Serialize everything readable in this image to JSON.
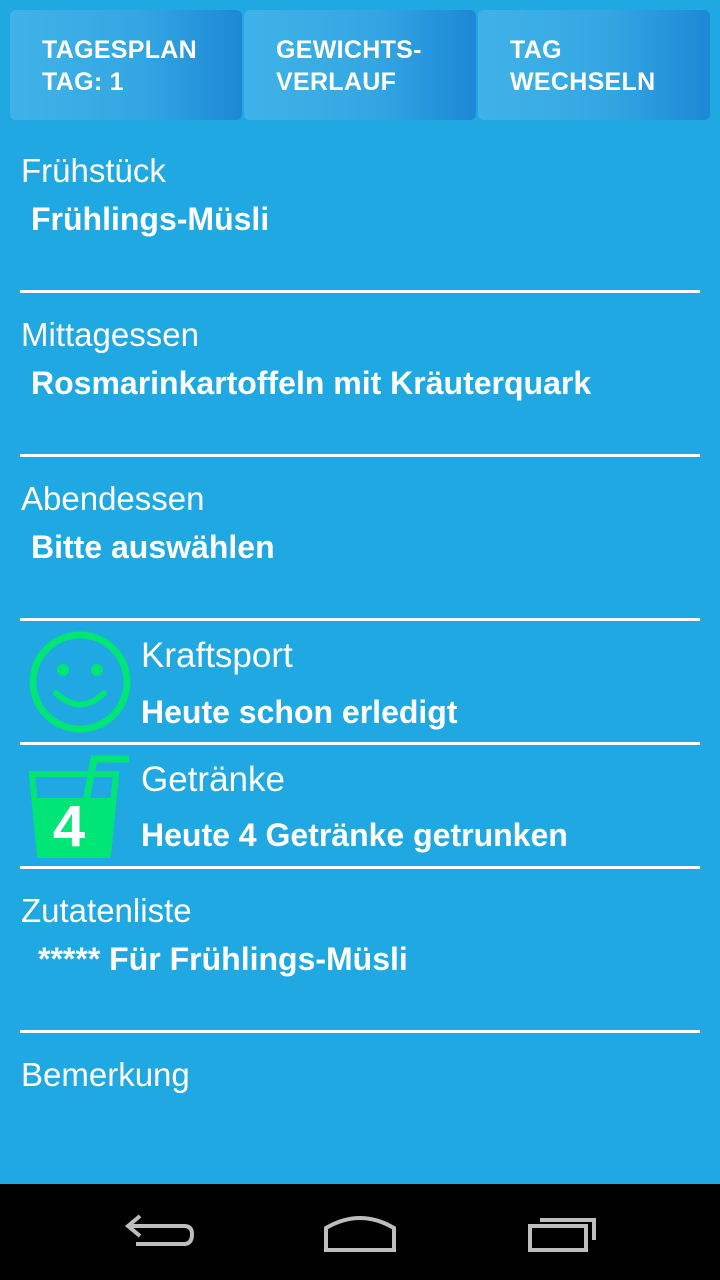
{
  "tabs": [
    {
      "line1": "TAGESPLAN",
      "line2": "TAG: 1"
    },
    {
      "line1": "GEWICHTS-",
      "line2": "VERLAUF"
    },
    {
      "line1": "TAG",
      "line2": "WECHSELN"
    }
  ],
  "breakfast": {
    "label": "Frühstück",
    "value": "Frühlings-Müsli"
  },
  "lunch": {
    "label": "Mittagessen",
    "value": "Rosmarinkartoffeln mit Kräuterquark"
  },
  "dinner": {
    "label": "Abendessen",
    "value": "Bitte auswählen"
  },
  "sport": {
    "label": "Kraftsport",
    "value": "Heute schon erledigt",
    "icon": "smiley-icon"
  },
  "drinks": {
    "label": "Getränke",
    "value": "Heute 4 Getränke getrunken",
    "count": "4",
    "icon": "drink-glass-icon"
  },
  "ingredients": {
    "label": "Zutatenliste",
    "value": "***** Für Frühlings-Müsli"
  },
  "note": {
    "label": "Bemerkung"
  },
  "colors": {
    "background": "#20a8e3",
    "accent_green": "#00e676",
    "navbar": "#000000"
  },
  "navbar": {
    "icons": [
      "back-icon",
      "home-icon",
      "recent-apps-icon"
    ]
  }
}
